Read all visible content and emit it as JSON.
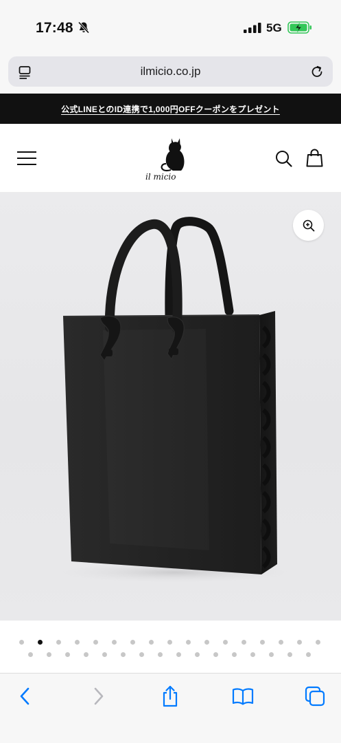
{
  "status_bar": {
    "time": "17:48",
    "network": "5G",
    "icons": [
      "bell-slash-icon",
      "signal-icon",
      "battery-charging-icon"
    ]
  },
  "browser": {
    "url": "ilmicio.co.jp",
    "icons": [
      "reader-icon",
      "reload-icon"
    ]
  },
  "announcement": {
    "text": "公式LINEとのID連携で1,000円OFFクーポンをプレゼント"
  },
  "header": {
    "logo_text": "il micio",
    "icons": [
      "menu-icon",
      "cat-logo",
      "search-icon",
      "bag-icon"
    ]
  },
  "product": {
    "image": "black-leather-tote-bag",
    "zoom_icon": "zoom-in-icon"
  },
  "carousel": {
    "row1_count": 17,
    "row2_count": 16,
    "active_index": 1
  },
  "toolbar": {
    "icons": [
      "back-icon",
      "forward-icon",
      "share-icon",
      "bookmarks-icon",
      "tabs-icon"
    ],
    "forward_disabled": true
  },
  "colors": {
    "accent": "#007aff",
    "announcement_bg": "#111111",
    "battery_green": "#34c759"
  }
}
